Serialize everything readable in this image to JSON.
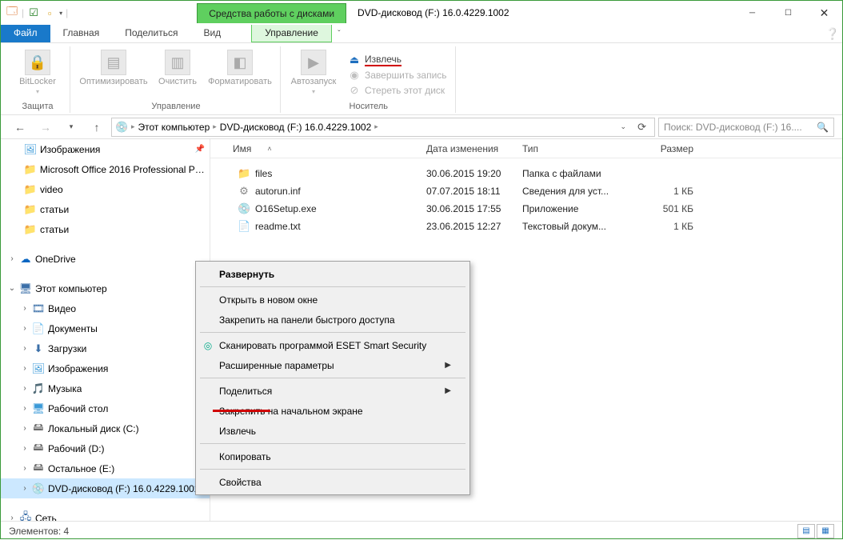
{
  "titlebar": {
    "context_tab": "Средства работы с дисками",
    "window_title": "DVD-дисковод (F:) 16.0.4229.1002"
  },
  "tabs": {
    "file": "Файл",
    "home": "Главная",
    "share": "Поделиться",
    "view": "Вид",
    "manage": "Управление"
  },
  "ribbon": {
    "protect_group": "Защита",
    "bitlocker": "BitLocker",
    "manage_group": "Управление",
    "optimize": "Оптимизировать",
    "cleanup": "Очистить",
    "format": "Форматировать",
    "autoplay": "Автозапуск",
    "media_group": "Носитель",
    "eject": "Извлечь",
    "finish": "Завершить запись",
    "erase": "Стереть этот диск"
  },
  "breadcrumb": {
    "root": "Этот компьютер",
    "current": "DVD-дисковод (F:) 16.0.4229.1002"
  },
  "search": {
    "placeholder": "Поиск: DVD-дисковод (F:) 16...."
  },
  "nav": {
    "pictures": "Изображения",
    "office": "Microsoft Office 2016 Professional Plus",
    "video": "video",
    "articles1": "статьи",
    "articles2": "статьи",
    "onedrive": "OneDrive",
    "thispc": "Этот компьютер",
    "videos": "Видео",
    "documents": "Документы",
    "downloads": "Загрузки",
    "pictures2": "Изображения",
    "music": "Музыка",
    "desktop": "Рабочий стол",
    "localc": "Локальный диск (C:)",
    "workd": "Рабочий (D:)",
    "othere": "Остальное (E:)",
    "dvdf": "DVD-дисковод (F:) 16.0.4229.1002",
    "network": "Сеть"
  },
  "columns": {
    "name": "Имя",
    "date": "Дата изменения",
    "type": "Тип",
    "size": "Размер"
  },
  "files": [
    {
      "name": "files",
      "date": "30.06.2015 19:20",
      "type": "Папка с файлами",
      "size": "",
      "icon": "folder"
    },
    {
      "name": "autorun.inf",
      "date": "07.07.2015 18:11",
      "type": "Сведения для уст...",
      "size": "1 КБ",
      "icon": "inf"
    },
    {
      "name": "O16Setup.exe",
      "date": "30.06.2015 17:55",
      "type": "Приложение",
      "size": "501 КБ",
      "icon": "exe"
    },
    {
      "name": "readme.txt",
      "date": "23.06.2015 12:27",
      "type": "Текстовый докум...",
      "size": "1 КБ",
      "icon": "txt"
    }
  ],
  "context_menu": {
    "expand": "Развернуть",
    "open_new": "Открыть в новом окне",
    "pin_quick": "Закрепить на панели быстрого доступа",
    "eset": "Сканировать программой ESET Smart Security",
    "advanced": "Расширенные параметры",
    "share": "Поделиться",
    "pin_start": "Закрепить на начальном экране",
    "eject": "Извлечь",
    "copy": "Копировать",
    "properties": "Свойства"
  },
  "status": {
    "items": "Элементов: 4"
  }
}
